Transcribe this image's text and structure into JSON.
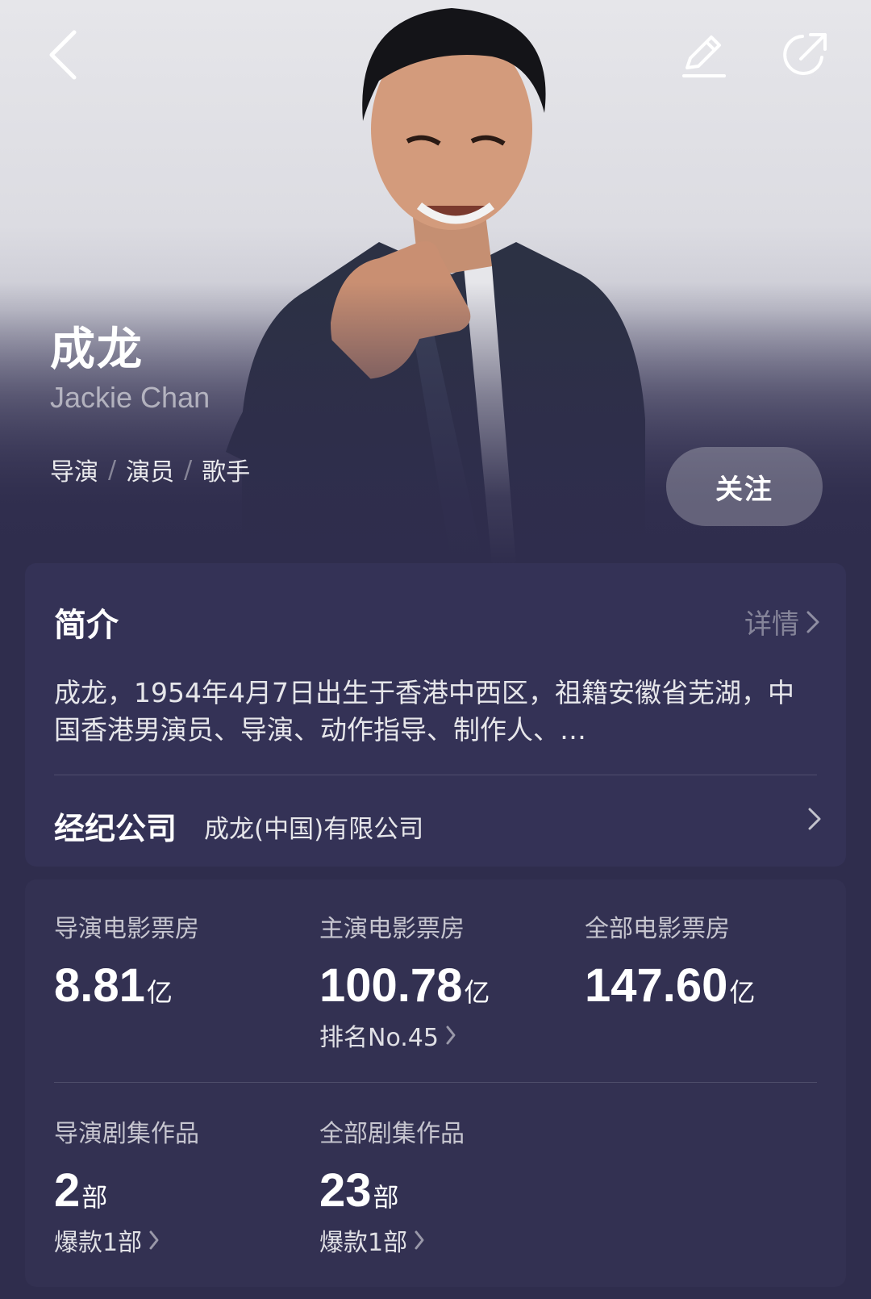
{
  "header": {
    "back_icon": "chevron-left-icon",
    "edit_icon": "pencil-icon",
    "share_icon": "share-icon"
  },
  "profile": {
    "name_zh": "成龙",
    "name_en": "Jackie Chan",
    "roles": [
      "导演",
      "演员",
      "歌手"
    ],
    "role_separator": "/",
    "follow_label": "关注"
  },
  "intro": {
    "title": "简介",
    "more_label": "详情",
    "text": "成龙，1954年4月7日出生于香港中西区，祖籍安徽省芜湖，中国香港男演员、导演、动作指导、制作人、…",
    "agency_label": "经纪公司",
    "agency_value": "成龙(中国)有限公司"
  },
  "stats": {
    "box_office": [
      {
        "label": "导演电影票房",
        "value": "8.81",
        "unit": "亿",
        "sub": ""
      },
      {
        "label": "主演电影票房",
        "value": "100.78",
        "unit": "亿",
        "sub": "排名No.45"
      },
      {
        "label": "全部电影票房",
        "value": "147.60",
        "unit": "亿",
        "sub": ""
      }
    ],
    "series": [
      {
        "label": "导演剧集作品",
        "value": "2",
        "unit": "部",
        "sub": "爆款1部"
      },
      {
        "label": "全部剧集作品",
        "value": "23",
        "unit": "部",
        "sub": "爆款1部"
      }
    ]
  },
  "colors": {
    "background": "#2f2d4d",
    "card": "#343256"
  }
}
